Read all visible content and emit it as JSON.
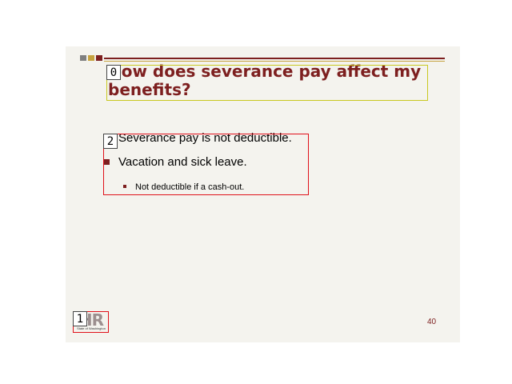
{
  "slide": {
    "title": "How does severance pay affect my benefits?",
    "bullets": [
      "Severance pay is not deductible.",
      "Vacation and sick leave.",
      "Not deductible if a cash-out."
    ],
    "page_number": "40",
    "logo": {
      "letters": "HR",
      "caption": "State of Washington"
    }
  },
  "annotations": {
    "title_box": "0",
    "logo_box": "1",
    "body_box": "2"
  },
  "colors": {
    "slide_background": "#f4f3ee",
    "accent_dark_red": "#7d1f1f",
    "accent_gold": "#c6a23f",
    "annotation_title": "#c8c820",
    "annotation_other": "#e0101a"
  }
}
